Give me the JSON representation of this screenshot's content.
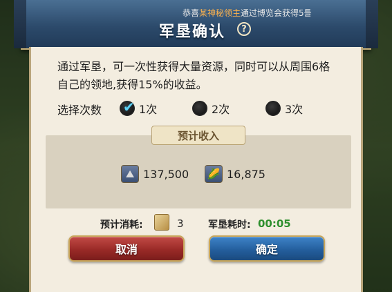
{
  "ticker": {
    "prefix": "恭喜",
    "highlight": "某神秘领主",
    "suffix": "通过博览会获得5틀"
  },
  "dialog": {
    "title": "军垦确认",
    "description": "通过军垦，可一次性获得大量资源，同时可以从周围6格自己的领地,获得15%的收益。",
    "times_label": "选择次数",
    "options": [
      {
        "label": "1次",
        "selected": true
      },
      {
        "label": "2次",
        "selected": false
      },
      {
        "label": "3次",
        "selected": false
      }
    ],
    "income_tag": "预计收入",
    "resources": [
      {
        "icon": "stone-icon",
        "value": "137,500"
      },
      {
        "icon": "corn-icon",
        "value": "16,875"
      }
    ],
    "cost_label": "预计消耗:",
    "cost_value": "3",
    "time_label": "军垦耗时:",
    "time_value": "00:05",
    "cancel_label": "取消",
    "ok_label": "确定"
  }
}
